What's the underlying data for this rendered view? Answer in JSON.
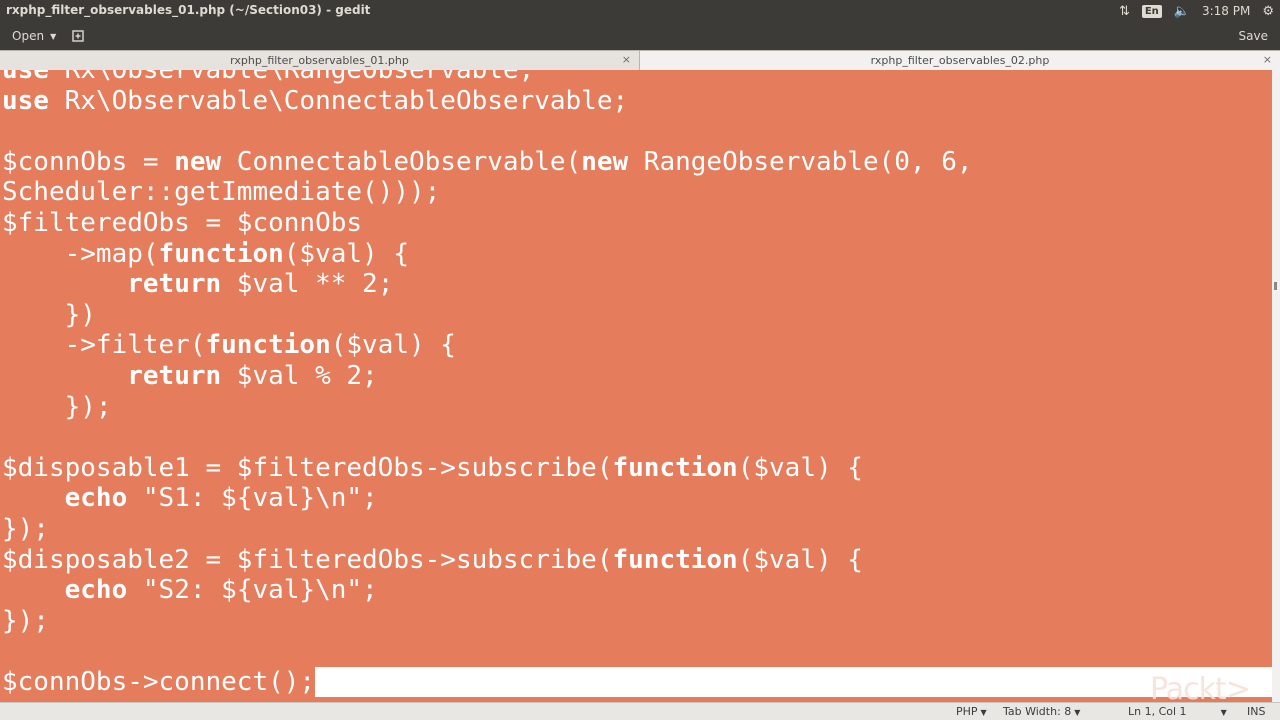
{
  "window": {
    "title": "rxphp_filter_observables_01.php (~/Section03) - gedit"
  },
  "tray": {
    "language": "En",
    "time": "3:18 PM"
  },
  "toolbar": {
    "open_label": "Open",
    "save_label": "Save"
  },
  "tabs": [
    {
      "label": "rxphp_filter_observables_01.php",
      "close": "×"
    },
    {
      "label": "rxphp_filter_observables_02.php",
      "close": "×"
    }
  ],
  "code": {
    "lines": [
      "use Rx\\Observable\\RangeObservable;",
      "use Rx\\Observable\\ConnectableObservable;",
      "",
      "$connObs = new ConnectableObservable(new RangeObservable(0, 6,",
      "Scheduler::getImmediate()));",
      "$filteredObs = $connObs",
      "    ->map(function($val) {",
      "        return $val ** 2;",
      "    })",
      "    ->filter(function($val) {",
      "        return $val % 2;",
      "    });",
      "",
      "$disposable1 = $filteredObs->subscribe(function($val) {",
      "    echo \"S1: ${val}\\n\";",
      "});",
      "$disposable2 = $filteredObs->subscribe(function($val) {",
      "    echo \"S2: ${val}\\n\";",
      "});",
      "",
      "$connObs->connect();"
    ]
  },
  "statusbar": {
    "language": "PHP",
    "tab_width": "Tab Width: 8",
    "position": "Ln 1, Col 1",
    "mode": "INS"
  },
  "watermark": "Packt>",
  "colors": {
    "selection": "#e57c5c",
    "panel": "#3c3b37"
  }
}
